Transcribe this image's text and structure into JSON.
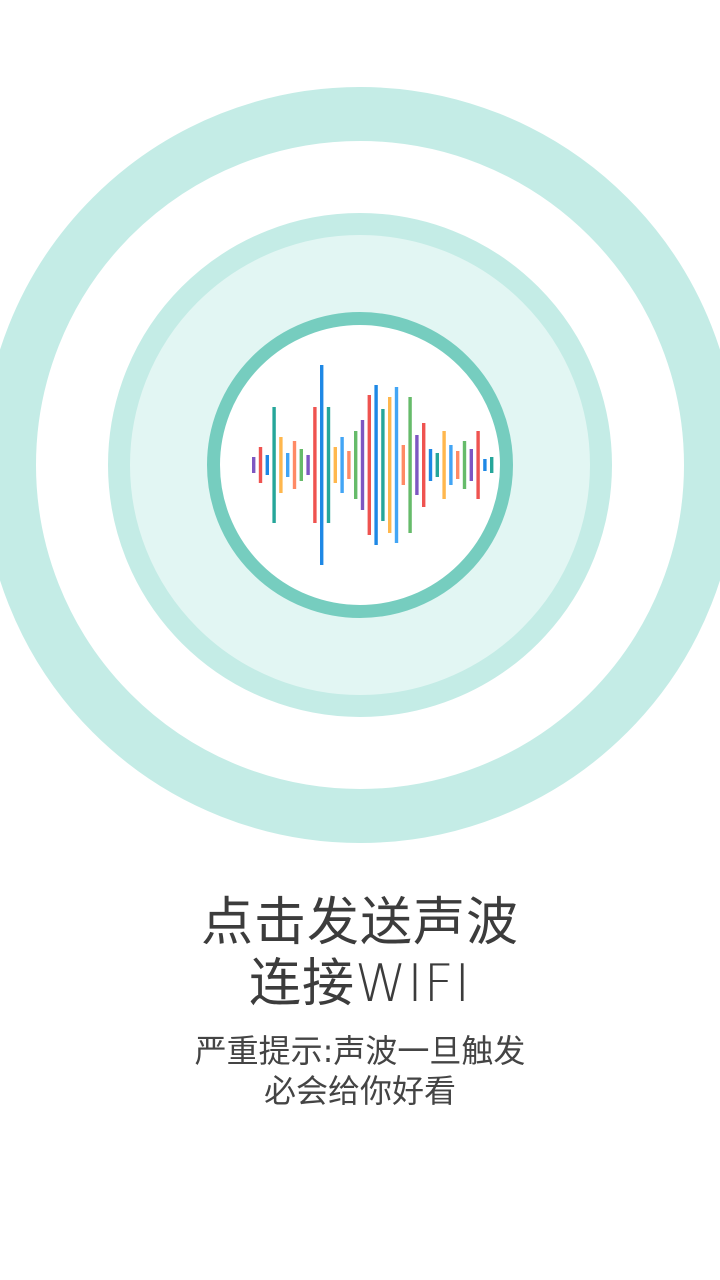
{
  "app": {
    "rings": {
      "outer_color": "#c4ece6",
      "middle_color": "#c4ece6",
      "middle_fill": "#e2f6f3",
      "button_border_color": "#76cdbf"
    },
    "sound_button": {
      "icon": "sound-wave-icon",
      "wave_colors": [
        "#7e57c2",
        "#ef5350",
        "#1e88e5",
        "#26a69a",
        "#ffb74d",
        "#42a5f5",
        "#ff8a65",
        "#66bb6a"
      ]
    },
    "title": {
      "line1": "点击发送声波",
      "line2": "连接WIFI"
    },
    "warning": {
      "line1": "严重提示:声波一旦触发",
      "line2": "必会给你好看"
    }
  }
}
